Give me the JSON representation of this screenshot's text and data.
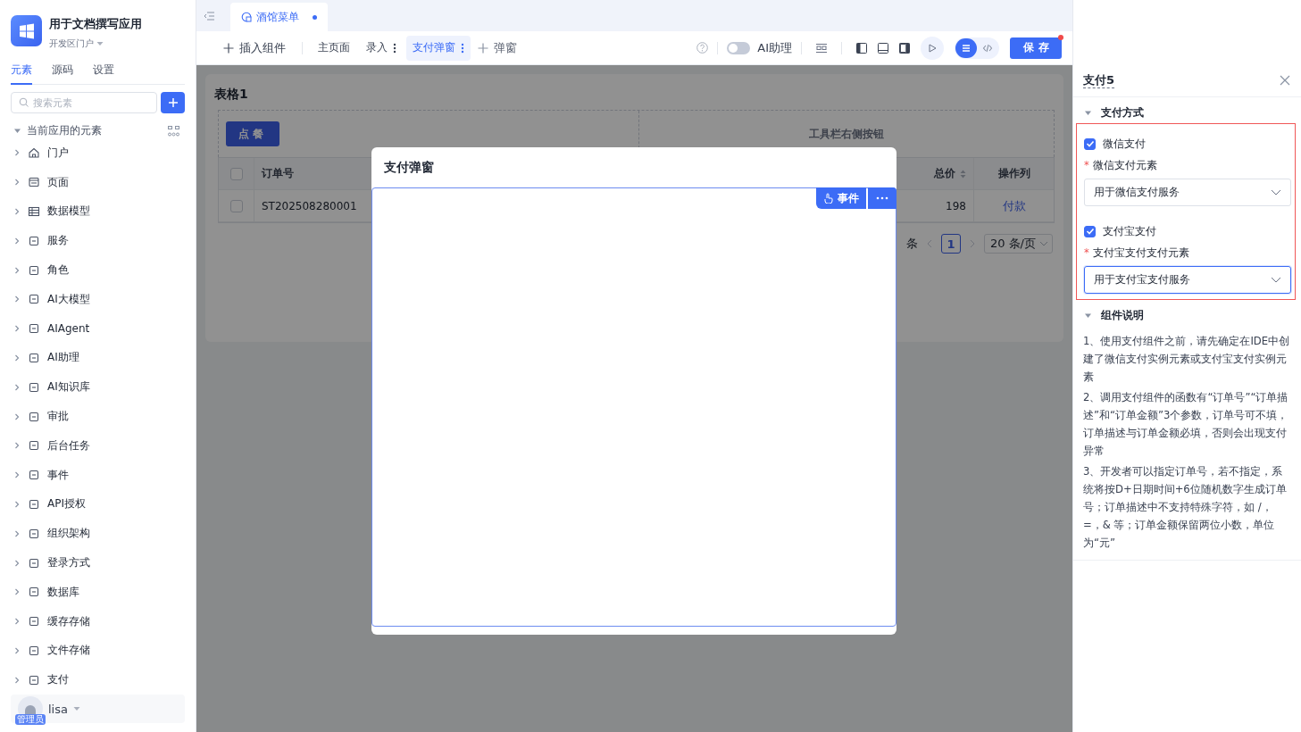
{
  "app": {
    "name": "用于文档撰写应用",
    "portal": "开发区门户"
  },
  "sidebar_tabs": [
    {
      "label": "元素",
      "selected": true
    },
    {
      "label": "源码",
      "selected": false
    },
    {
      "label": "设置",
      "selected": false
    }
  ],
  "search": {
    "placeholder": "搜索元素"
  },
  "element_group": {
    "label": "当前应用的元素",
    "expanded": true,
    "items": [
      {
        "label": "门户",
        "expanded": false
      },
      {
        "label": "页面",
        "expanded": false
      },
      {
        "label": "数据模型",
        "expanded": false
      },
      {
        "label": "服务",
        "expanded": false
      },
      {
        "label": "角色",
        "expanded": false
      },
      {
        "label": "AI大模型",
        "expanded": false
      },
      {
        "label": "AIAgent",
        "expanded": false
      },
      {
        "label": "AI助理",
        "expanded": false
      },
      {
        "label": "AI知识库",
        "expanded": false
      },
      {
        "label": "审批",
        "expanded": false
      },
      {
        "label": "后台任务",
        "expanded": false
      },
      {
        "label": "事件",
        "expanded": false
      },
      {
        "label": "API授权",
        "expanded": false
      },
      {
        "label": "组织架构",
        "expanded": false
      },
      {
        "label": "登录方式",
        "expanded": false
      },
      {
        "label": "数据库",
        "expanded": false
      },
      {
        "label": "缓存存储",
        "expanded": false
      },
      {
        "label": "文件存储",
        "expanded": false
      },
      {
        "label": "支付",
        "expanded": false
      }
    ]
  },
  "user": {
    "name": "lisa",
    "role": "管理员"
  },
  "editor_tabs": [
    {
      "label": "酒馆菜单",
      "selected": true,
      "unsaved": true
    }
  ],
  "toolbar": {
    "insert": "插入组件",
    "pages": [
      {
        "label": "主页面",
        "selected": false,
        "menu": false
      },
      {
        "label": "录入",
        "selected": false,
        "menu": true
      },
      {
        "label": "支付弹窗",
        "selected": true,
        "menu": true
      }
    ],
    "add_popup": "弹窗",
    "ai_assistant": {
      "label": "AI助理",
      "on": false
    },
    "view_modes": [
      {
        "kind": "design",
        "selected": true
      },
      {
        "kind": "code",
        "selected": false
      }
    ],
    "save": "保存",
    "save_pending": true
  },
  "canvas": {
    "table": {
      "title": "表格1",
      "toolbar_button": "点餐",
      "toolbar_right": "工具栏右侧按钮",
      "select_all": {
        "checked": false
      },
      "columns": [
        {
          "label": "订单号",
          "sortable": false
        },
        {
          "label": "总价",
          "sortable": true
        },
        {
          "label": "操作列",
          "sortable": false
        }
      ],
      "rows": [
        {
          "checked": false,
          "cells": [
            "ST202508280001",
            "198",
            "付款"
          ]
        }
      ],
      "pagination": {
        "total_suffix": "条",
        "page": "1",
        "page_size": "20 条/页"
      }
    },
    "dialog": {
      "title": "支付弹窗",
      "event_button": "事件"
    }
  },
  "properties": {
    "title": "支付5",
    "sections": [
      {
        "kind": "payment",
        "title": "支付方式",
        "expanded": true,
        "methods": [
          {
            "label": "微信支付",
            "checked": true,
            "required_mark": "*",
            "field_label": "微信支付元素",
            "value": "用于微信支付服务",
            "focused": false
          },
          {
            "label": "支付宝支付",
            "checked": true,
            "required_mark": "*",
            "field_label": "支付宝支付支付元素",
            "value": "用于支付宝支付服务",
            "focused": true
          }
        ]
      },
      {
        "kind": "notes",
        "title": "组件说明",
        "expanded": true,
        "paragraphs": [
          "1、使用支付组件之前，请先确定在IDE中创建了微信支付实例元素或支付宝支付实例元素",
          "2、调用支付组件的函数有“订单号”“订单描述”和“订单金额”3个参数，订单号可不填，订单描述与订单金额必填，否则会出现支付异常",
          "3、开发者可以指定订单号，若不指定，系统将按D+日期时间+6位随机数字生成订单号；订单描述中不支持特殊字符，如 /，=，& 等；订单金额保留两位小数，单位为“元”"
        ]
      }
    ]
  }
}
